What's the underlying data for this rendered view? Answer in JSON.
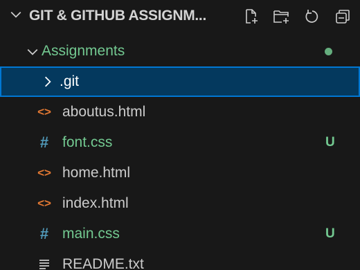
{
  "header": {
    "title": "GIT & GITHUB ASSIGNM...",
    "actions": [
      "new-file",
      "new-folder",
      "refresh",
      "collapse-all"
    ]
  },
  "tree": {
    "folder": {
      "label": "Assignments",
      "color": "#73c991",
      "expanded": true
    },
    "items": [
      {
        "label": ".git",
        "icon": "chevron-right",
        "selected": true,
        "color": "#ffffff"
      },
      {
        "label": "aboutus.html",
        "icon": "html-file-icon",
        "color": "#cccccc"
      },
      {
        "label": "font.css",
        "icon": "css-file-icon",
        "color": "#73c991",
        "status": "U"
      },
      {
        "label": "home.html",
        "icon": "html-file-icon",
        "color": "#cccccc"
      },
      {
        "label": "index.html",
        "icon": "html-file-icon",
        "color": "#cccccc"
      },
      {
        "label": "main.css",
        "icon": "css-file-icon",
        "color": "#73c991",
        "status": "U"
      },
      {
        "label": "README.txt",
        "icon": "text-file-icon",
        "color": "#cccccc"
      }
    ]
  },
  "colors": {
    "background": "#181818",
    "selection": "#04395e",
    "focus_border": "#0078d4",
    "untracked": "#73c991",
    "html_icon": "#e37933",
    "css_icon": "#519aba"
  }
}
